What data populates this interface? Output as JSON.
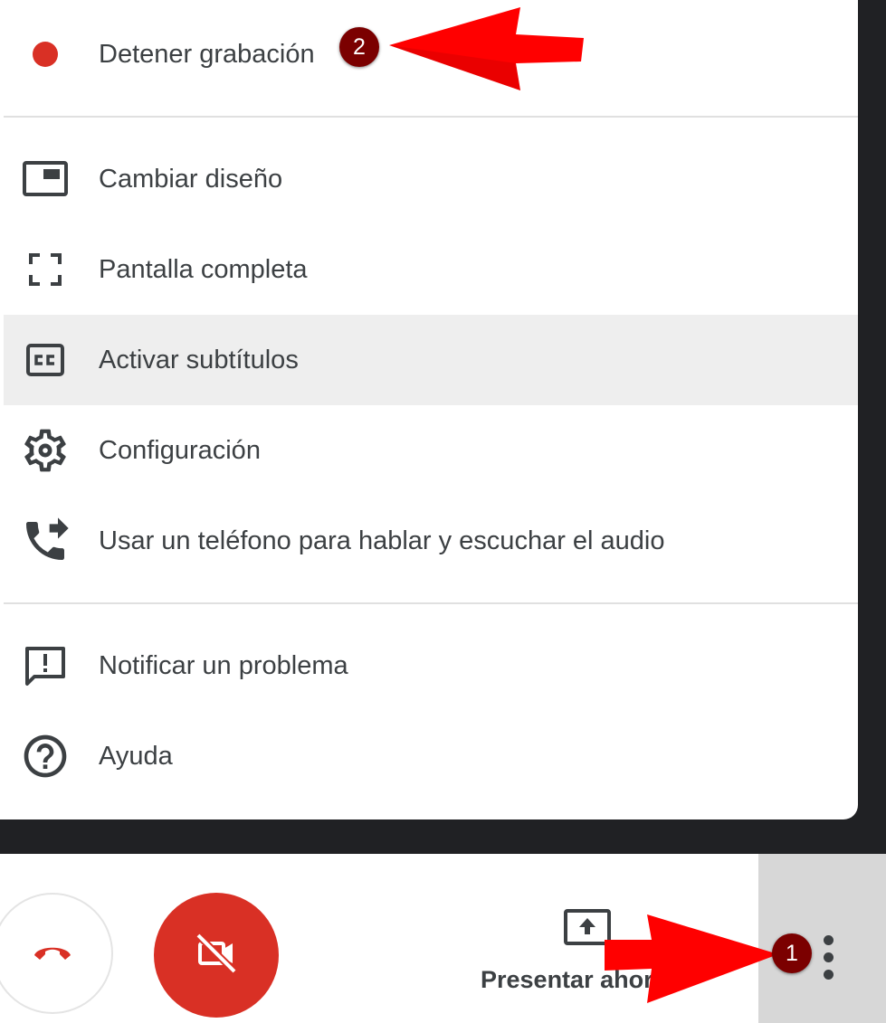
{
  "menu": {
    "items": [
      {
        "label": "Detener grabación",
        "icon": "record-dot-icon"
      },
      {
        "label": "Cambiar diseño",
        "icon": "layout-icon"
      },
      {
        "label": "Pantalla completa",
        "icon": "fullscreen-icon"
      },
      {
        "label": "Activar subtítulos",
        "icon": "closed-captions-icon"
      },
      {
        "label": "Configuración",
        "icon": "gear-icon"
      },
      {
        "label": "Usar un teléfono para hablar y escuchar el audio",
        "icon": "phone-forward-icon"
      },
      {
        "label": "Notificar un problema",
        "icon": "feedback-icon"
      },
      {
        "label": "Ayuda",
        "icon": "help-icon"
      }
    ],
    "highlighted": "Activar subtítulos"
  },
  "toolbar": {
    "present_label": "Presentar ahora",
    "hangup_icon": "hangup-icon",
    "camera_icon": "camera-off-icon",
    "present_icon": "present-screen-icon",
    "more_icon": "more-vert-icon"
  },
  "annotations": {
    "badge_1": "1",
    "badge_2": "2"
  },
  "colors": {
    "record_red": "#d93025",
    "annotation_red": "#ff0000",
    "badge_bg": "#7b0000",
    "text": "#3c4043"
  }
}
